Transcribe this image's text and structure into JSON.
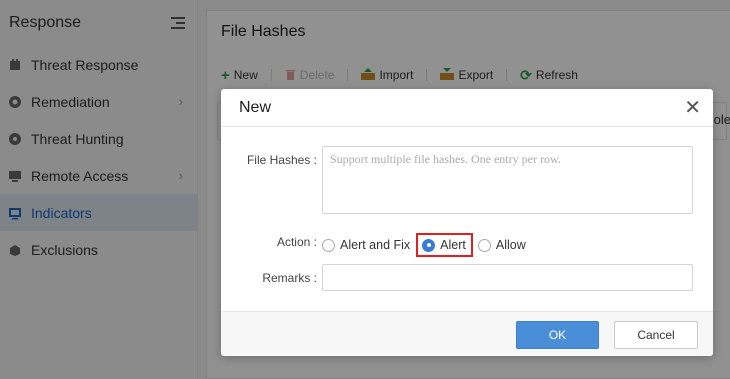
{
  "sidebar": {
    "title": "Response",
    "items": [
      {
        "label": "Threat Response",
        "icon": "bolt-icon",
        "chevron": false,
        "active": false
      },
      {
        "label": "Remediation",
        "icon": "gear-icon",
        "chevron": true,
        "active": false
      },
      {
        "label": "Threat Hunting",
        "icon": "target-icon",
        "chevron": false,
        "active": false
      },
      {
        "label": "Remote Access",
        "icon": "monitor-icon",
        "chevron": true,
        "active": false
      },
      {
        "label": "Indicators",
        "icon": "indicator-icon",
        "chevron": false,
        "active": true
      },
      {
        "label": "Exclusions",
        "icon": "exclusion-icon",
        "chevron": false,
        "active": false
      }
    ]
  },
  "main": {
    "title": "File Hashes",
    "toolbar": {
      "new": "New",
      "delete": "Delete",
      "import": "Import",
      "export": "Export",
      "refresh": "Refresh"
    },
    "table_header_fragment": "ole"
  },
  "dialog": {
    "title": "New",
    "hashes_label": "File Hashes :",
    "hashes_placeholder": "Support multiple file hashes. One entry per row.",
    "action_label": "Action :",
    "actions": [
      "Alert and Fix",
      "Alert",
      "Allow"
    ],
    "selected_action": "Alert",
    "remarks_label": "Remarks :",
    "remarks_value": "",
    "ok": "OK",
    "cancel": "Cancel"
  },
  "colors": {
    "accent": "#4a8ed8",
    "highlight_box": "#e02020",
    "active_nav": "#1a66c5",
    "new_icon": "#2f9a4b"
  }
}
